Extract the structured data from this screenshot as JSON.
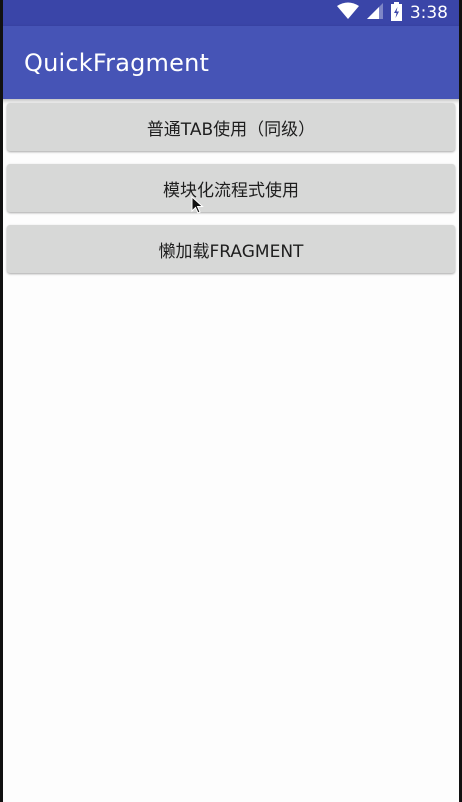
{
  "status_bar": {
    "time": "3:38",
    "icons": [
      "wifi-icon",
      "cell-signal-icon",
      "battery-charging-icon"
    ]
  },
  "app_bar": {
    "title": "QuickFragment",
    "background": "#4654b6",
    "status_background": "#3a45a8"
  },
  "buttons": [
    {
      "label": "普通TAB使用（同级）"
    },
    {
      "label": "模块化流程式使用"
    },
    {
      "label": "懒加载FRAGMENT"
    }
  ]
}
